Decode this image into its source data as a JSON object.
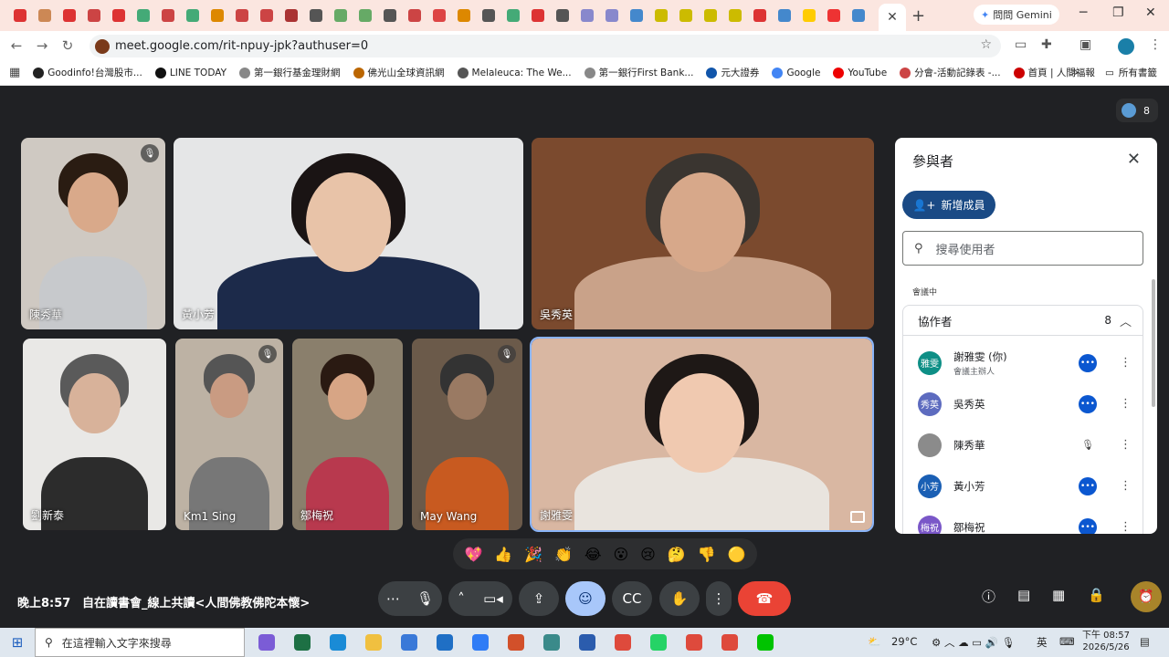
{
  "browser": {
    "tab_colors": [
      "#d33",
      "#c85",
      "#d33",
      "#c44",
      "#d33",
      "#4a7",
      "#c44",
      "#4a7",
      "#d80",
      "#c44",
      "#c44",
      "#a33",
      "#555",
      "#6a6",
      "#6a6",
      "#555",
      "#c44",
      "#d44",
      "#d80",
      "#555",
      "#4a7",
      "#d33",
      "#555",
      "#88c",
      "#88c",
      "#48c",
      "#cb0",
      "#cb0",
      "#cb0",
      "#cb0",
      "#d33",
      "#48c",
      "#fc0",
      "#e33",
      "#48c"
    ],
    "active_tab_close": "✕",
    "new_tab": "+",
    "gemini_label": "問問 Gemini",
    "url": "meet.google.com/rit-npuy-jpk?authuser=0",
    "bookmarks": [
      {
        "label": "Goodinfo!台灣股市...",
        "color": "#222"
      },
      {
        "label": "LINE TODAY",
        "color": "#111"
      },
      {
        "label": "第一銀行基金理財網",
        "color": "#888"
      },
      {
        "label": "佛光山全球資訊網",
        "color": "#b60"
      },
      {
        "label": "Melaleuca: The We...",
        "color": "#555"
      },
      {
        "label": "第一銀行First Bank...",
        "color": "#888"
      },
      {
        "label": "元大證券",
        "color": "#15a"
      },
      {
        "label": "Google",
        "color": "#4285f4"
      },
      {
        "label": "YouTube",
        "color": "#e00"
      },
      {
        "label": "分會-活動記錄表 -...",
        "color": "#c44"
      },
      {
        "label": "首頁 | 人間福報",
        "color": "#c00"
      }
    ],
    "bookmarks_more": "»",
    "all_bookmarks": "所有書籤"
  },
  "meet": {
    "participant_count": "8",
    "tiles": [
      {
        "name": "陳秀華",
        "muted": true,
        "bg": "#cfc9c2",
        "hair": "#2a1c12",
        "skin": "#d9a98a",
        "shirt": "#c7c9cc"
      },
      {
        "name": "黃小芳",
        "muted": false,
        "bg": "#e5e6e7",
        "hair": "#1a1414",
        "skin": "#e8c3a8",
        "shirt": "#1c2a4a"
      },
      {
        "name": "吳秀英",
        "muted": false,
        "bg": "#7b4a2e",
        "hair": "#3a3530",
        "skin": "#d7a88a",
        "shirt": "#c9a289"
      },
      {
        "name": "劉新泰",
        "muted": false,
        "bg": "#e9e8e6",
        "hair": "#5a5a5a",
        "skin": "#d8b29a",
        "shirt": "#2c2c2c"
      },
      {
        "name": "Km1 Sing",
        "muted": true,
        "bg": "#bdb2a4",
        "hair": "#555",
        "skin": "#c99b82",
        "shirt": "#777"
      },
      {
        "name": "鄒梅祝",
        "muted": false,
        "bg": "#8a7f6c",
        "hair": "#2a1a12",
        "skin": "#d7a585",
        "shirt": "#b8394e"
      },
      {
        "name": "May Wang",
        "muted": true,
        "bg": "#6b5a4a",
        "hair": "#333",
        "skin": "#9a7a63",
        "shirt": "#c85a20"
      },
      {
        "name": "謝雅雯",
        "muted": false,
        "bg": "#d9b7a2",
        "hair": "#1e1816",
        "skin": "#f0c9b0",
        "shirt": "#e9e4de"
      }
    ],
    "panel": {
      "title": "參與者",
      "add_label": "新增成員",
      "search_placeholder": "搜尋使用者",
      "section_label": "會議中",
      "group_label": "協作者",
      "group_count": "8",
      "people": [
        {
          "initials": "雅雯",
          "name": "謝雅雯 (你)",
          "sub": "會議主辦人",
          "color": "#0e8f86",
          "status": "more"
        },
        {
          "initials": "秀英",
          "name": "吳秀英",
          "sub": "",
          "color": "#5d6bbf",
          "status": "more"
        },
        {
          "initials": "",
          "name": "陳秀華",
          "sub": "",
          "color": "#8b8b8b",
          "status": "muted"
        },
        {
          "initials": "小芳",
          "name": "黃小芳",
          "sub": "",
          "color": "#1a5fb4",
          "status": "more"
        },
        {
          "initials": "梅祝",
          "name": "鄒梅祝",
          "sub": "",
          "color": "#7a57c8",
          "status": "more"
        }
      ]
    },
    "reactions": [
      "💖",
      "👍",
      "🎉",
      "👏",
      "😂",
      "😮",
      "😢",
      "🤔",
      "👎",
      "🟡"
    ],
    "clock": "晚上8:57",
    "meeting_title": "自在讀書會_線上共讀<人間佛教佛陀本懷>"
  },
  "taskbar": {
    "search_placeholder": "在這裡輸入文字來搜尋",
    "apps": [
      {
        "name": "copilot",
        "color": "#7b5cd6"
      },
      {
        "name": "excel",
        "color": "#1d7044"
      },
      {
        "name": "edge",
        "color": "#1a8bd6"
      },
      {
        "name": "file-explorer",
        "color": "#f0c040"
      },
      {
        "name": "store",
        "color": "#3a79d8"
      },
      {
        "name": "outlook",
        "color": "#1f6fc5"
      },
      {
        "name": "messenger",
        "color": "#2f7cf6"
      },
      {
        "name": "powerpoint",
        "color": "#d2502a"
      },
      {
        "name": "photos",
        "color": "#3a8a8a"
      },
      {
        "name": "word",
        "color": "#2b5cad"
      },
      {
        "name": "chrome",
        "color": "#de4a3c"
      },
      {
        "name": "whatsapp",
        "color": "#25d366"
      },
      {
        "name": "chrome2",
        "color": "#de4a3c"
      },
      {
        "name": "chrome3",
        "color": "#de4a3c"
      },
      {
        "name": "line",
        "color": "#00c300"
      }
    ],
    "temperature": "29°C",
    "ime": "英",
    "time": "下午 08:57",
    "date": "2026/5/26"
  }
}
